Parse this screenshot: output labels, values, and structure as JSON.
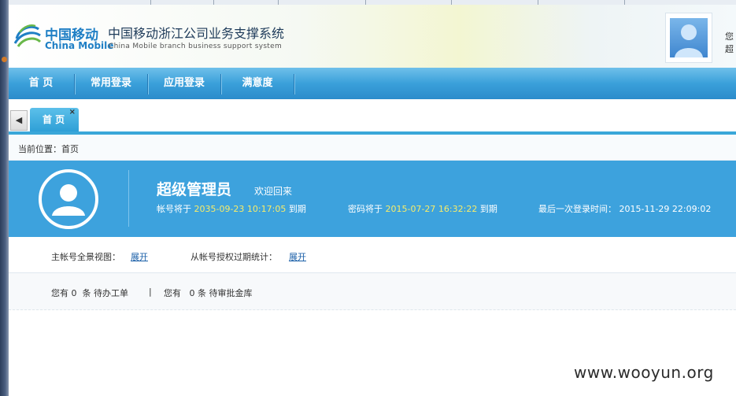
{
  "header": {
    "brand_cn": "中国移动",
    "brand_en": "China Mobile",
    "system_title_cn": "中国移动浙江公司业务支撑系统",
    "system_title_en": "China Mobile branch business support system",
    "user_line1": "您",
    "user_line2": "超"
  },
  "nav": [
    "首 页",
    "常用登录",
    "应用登录",
    "满意度"
  ],
  "tabs": {
    "scroll_left": "◀",
    "items": [
      {
        "label": "首 页",
        "close": "×"
      }
    ]
  },
  "breadcrumb": "当前位置：首页",
  "banner": {
    "username": "超级管理员",
    "welcome": "欢迎回来",
    "account_label": "帐号将于",
    "account_date": "2035-09-23 10:17:05",
    "password_label": "密码将于",
    "password_date": "2015-07-27 16:32:22",
    "expire_suffix": "到期",
    "last_login_label": "最后一次登录时间：",
    "last_login_time": "2015-11-29 22:09:02"
  },
  "stats": {
    "master_view_label": "主帐号全景视图：",
    "sub_expiry_label": "从帐号授权过期统计：",
    "expand": "展开"
  },
  "todo": {
    "pending_orders": "您有 0  条 待办工单",
    "separator": "|",
    "pending_vault": "您有   0 条 待审批金库"
  },
  "watermark": "www.wooyun.org",
  "colors": {
    "nav": "#3aa0da",
    "banner": "#3da2dd",
    "highlight_date": "#f7ec6a",
    "link": "#1a5fa8",
    "brand": "#1f7fc5"
  }
}
